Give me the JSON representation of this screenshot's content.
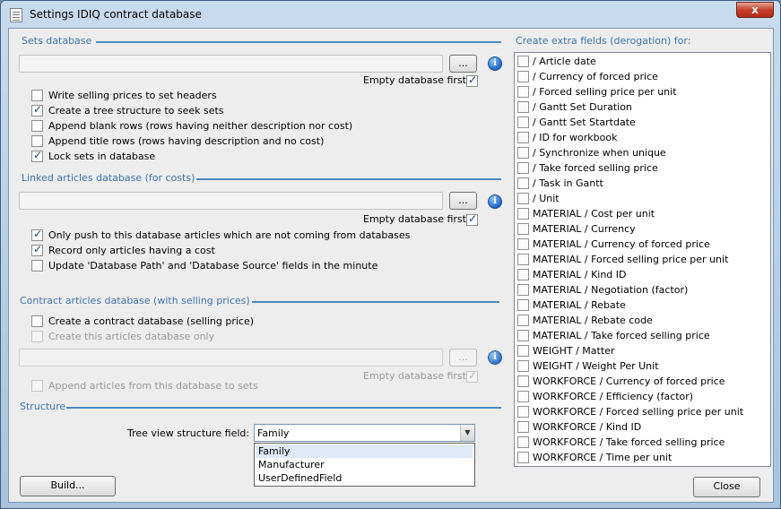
{
  "window": {
    "title": "Settings IDIQ contract database",
    "close_glyph": "x"
  },
  "sets": {
    "title": "Sets database",
    "browse_label": "...",
    "info_glyph": "i",
    "empty_first_label": "Empty database first",
    "empty_first_checked": true,
    "options": [
      {
        "label": "Write selling prices to set headers",
        "checked": false
      },
      {
        "label": "Create a tree structure to seek sets",
        "checked": true
      },
      {
        "label": "Append blank rows (rows having neither description nor cost)",
        "checked": false
      },
      {
        "label": "Append title rows (rows having description and no cost)",
        "checked": false
      },
      {
        "label": "Lock sets in database",
        "checked": true
      }
    ]
  },
  "linked": {
    "title": "Linked articles database (for costs)",
    "browse_label": "...",
    "info_glyph": "i",
    "empty_first_label": "Empty database first",
    "empty_first_checked": true,
    "options": [
      {
        "label": "Only push to this database articles which are not coming from databases",
        "checked": true
      },
      {
        "label": "Record only articles having a cost",
        "checked": true
      },
      {
        "label": "Update 'Database Path' and 'Database Source' fields in the minute",
        "checked": false
      }
    ]
  },
  "contract": {
    "title": "Contract articles database (with selling prices)",
    "create_label": "Create a contract database (selling price)",
    "create_only_label": "Create this articles database only",
    "browse_label": "...",
    "info_glyph": "i",
    "empty_first_label": "Empty database first",
    "append_label": "Append articles from this database to sets"
  },
  "structure": {
    "title": "Structure",
    "field_label": "Tree view structure field:",
    "selected": "Family",
    "arrow_glyph": "▼",
    "options": [
      "Family",
      "Manufacturer",
      "UserDefinedField"
    ]
  },
  "extra": {
    "title": "Create extra fields (derogation) for:",
    "fields": [
      " / Article date",
      " / Currency of forced price",
      " / Forced selling price per unit",
      " / Gantt Set Duration",
      " / Gantt Set Startdate",
      " / ID for workbook",
      " / Synchronize when unique",
      " / Take forced selling price",
      " / Task in Gantt",
      " / Unit",
      "MATERIAL / Cost per unit",
      "MATERIAL / Currency",
      "MATERIAL / Currency of forced price",
      "MATERIAL / Forced selling price per unit",
      "MATERIAL / Kind ID",
      "MATERIAL / Negotiation (factor)",
      "MATERIAL / Rebate",
      "MATERIAL / Rebate code",
      "MATERIAL / Take forced selling price",
      "WEIGHT / Matter",
      "WEIGHT / Weight Per Unit",
      "WORKFORCE / Currency of forced price",
      "WORKFORCE / Efficiency (factor)",
      "WORKFORCE / Forced selling price per unit",
      "WORKFORCE / Kind ID",
      "WORKFORCE / Take forced selling price",
      "WORKFORCE / Time per unit"
    ]
  },
  "footer": {
    "build_label": "Build...",
    "close_label": "Close"
  }
}
